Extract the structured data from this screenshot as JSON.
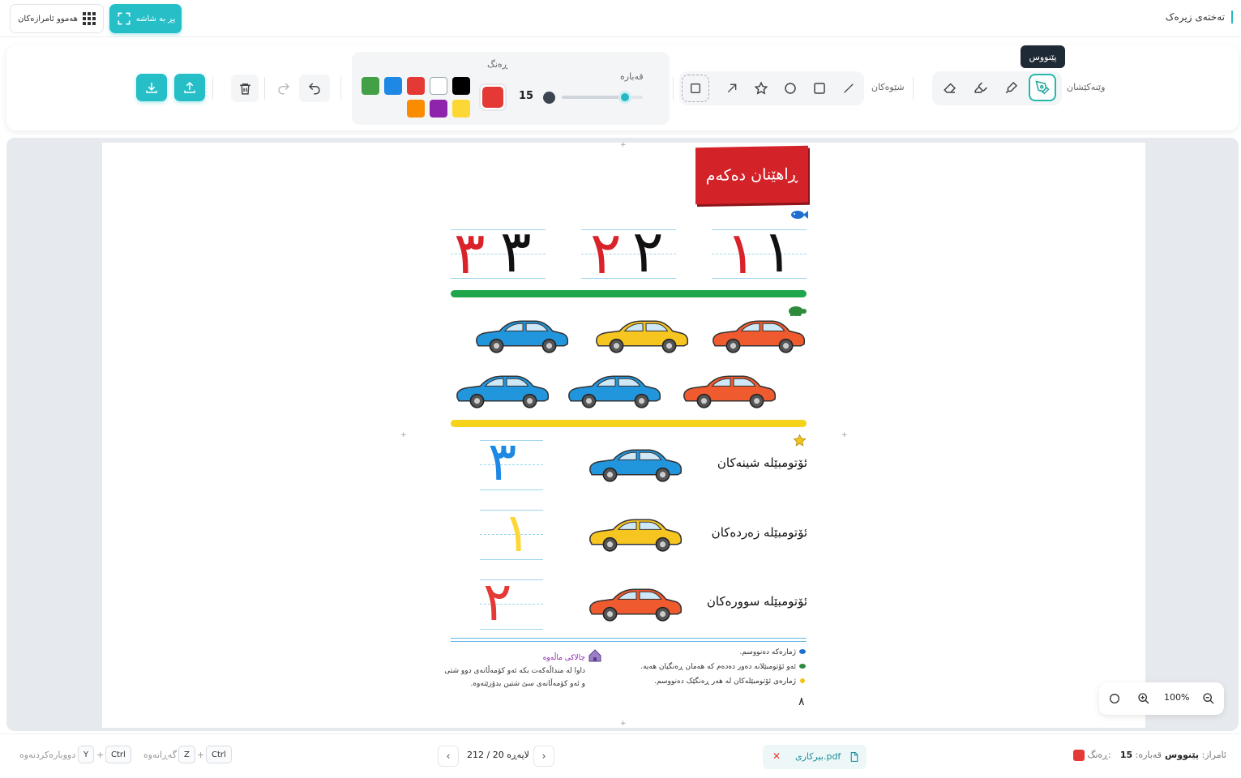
{
  "header": {
    "app_title": "تەختەی زیرەک",
    "all_tools_label": "هەموو ئامرازەکان",
    "fullscreen_label": "پڕ بە شاشە"
  },
  "toolbar": {
    "drawing_label": "وێنەکێشان",
    "shapes_label": "شێوەکان",
    "size_label": "قەبارە",
    "color_label": "ڕەنگ",
    "size_value": "15",
    "size_fraction": 0.78,
    "tooltip": "پێنووس",
    "current_color": "#e53935",
    "palette": [
      "#000000",
      "#ffffff",
      "#e53935",
      "#1e88e5",
      "#43a047",
      "#fdd835",
      "#8e24aa",
      "#fb8c00"
    ]
  },
  "worksheet": {
    "banner": "ڕاهێنان دەکەم",
    "numbers_row": [
      "١",
      "٢",
      "٣"
    ],
    "traced_row": [
      "١",
      "٢",
      "٣"
    ],
    "label_blue": "ئۆتومبێلە شینەکان",
    "label_yellow": "ئۆتومبێلە زەردەکان",
    "label_red": "ئۆتومبێلە سوورەکان",
    "answer_blue": "٣",
    "answer_yellow": "١",
    "answer_red": "٢",
    "instr_1": "ژمارەکە دەنووسم.",
    "instr_2": "ئەو ئۆتومبێلانە دەور دەدەم کە هەمان ڕەنگیان هەیە.",
    "instr_3": "ژمارەی ئۆتومبێلەکان لە هەر ڕەنگێک دەنووسم.",
    "parent_title": "چالاکی ماڵەوە",
    "parent_text": "داوا لە منداڵەکەت بکە ئەو کۆمەڵانەی دوو شتی و ئەو کۆمەڵانەی سێ شتین بدۆزێتەوە.",
    "page_number": "٨"
  },
  "zoom": {
    "level": "100%"
  },
  "statusbar": {
    "tool_label": "ئامراز:",
    "tool_value": "پێنووس",
    "size_label": "قەبارە:",
    "size_value": "15",
    "color_label": "ڕەنگ:",
    "file_name": "بیرکاری.pdf",
    "page_label": "لاپەڕە 20 / 212",
    "ctrl": "Ctrl",
    "z_key": "Z",
    "y_key": "Y",
    "undo_hint": "گەڕانەوە",
    "redo_hint": "دووبارەکردنەوە"
  },
  "colors": {
    "accent": "#26bfc8",
    "red": "#e53935",
    "blue": "#1e88e5",
    "yellow": "#fdd835"
  }
}
